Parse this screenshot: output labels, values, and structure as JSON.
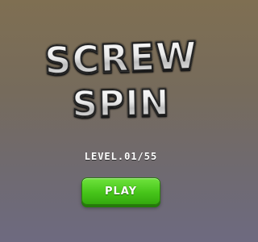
{
  "title": {
    "line1": "SCREW",
    "line2": "SPIN"
  },
  "level": {
    "text": "LEVEL.01/55"
  },
  "play_button": {
    "label": "PLAY"
  },
  "colors": {
    "background_top": "#7f6f52",
    "background_bottom": "#6e6a80",
    "play_button": "#47c51a",
    "logo_text": "#f2f2f2",
    "logo_outline": "#1d1d1d"
  }
}
